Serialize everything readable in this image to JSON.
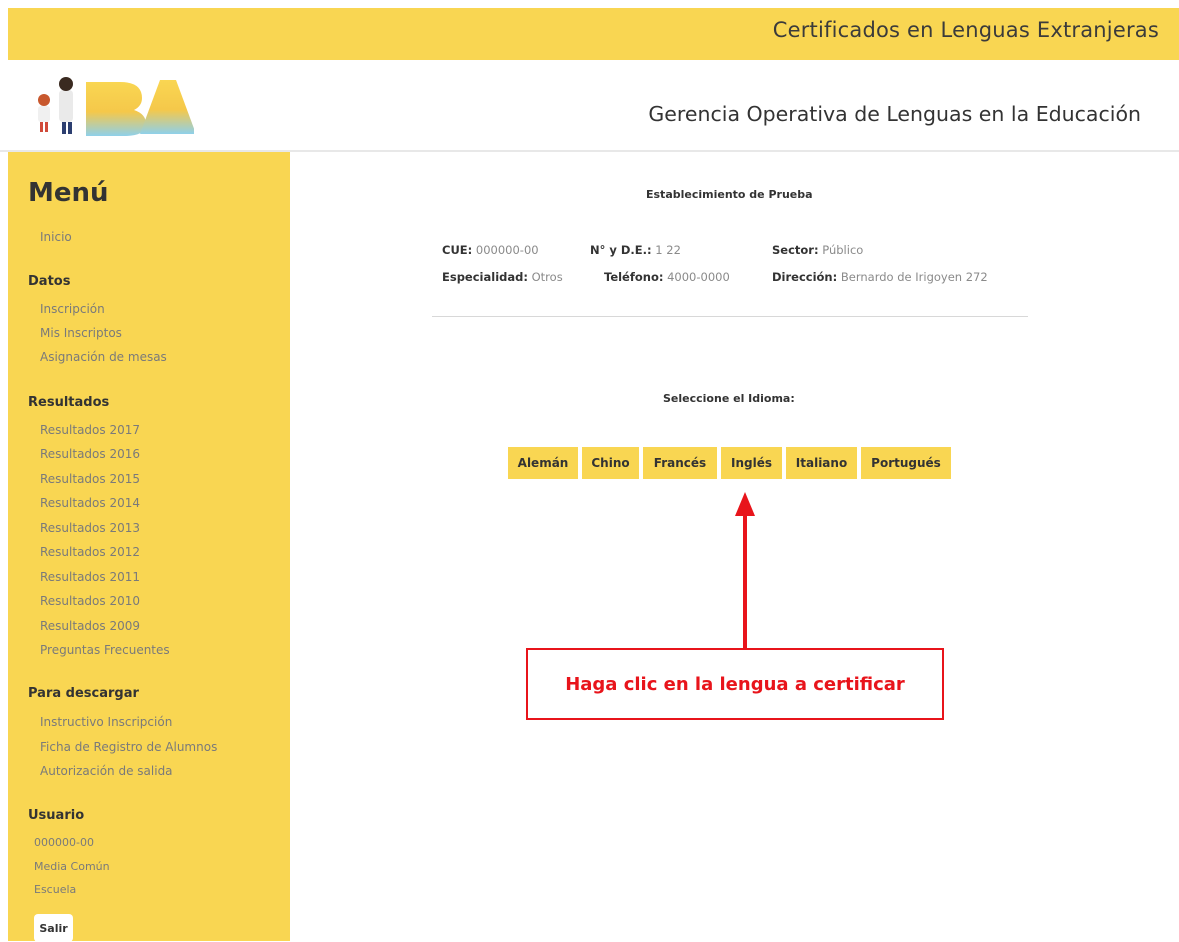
{
  "banner": {
    "title": "Certificados en Lenguas Extranjeras"
  },
  "header": {
    "subtitle": "Gerencia Operativa de Lenguas en la Educación"
  },
  "sidebar": {
    "menu_title": "Menú",
    "inicio": "Inicio",
    "datos": {
      "heading": "Datos",
      "items": [
        "Inscripción",
        "Mis Inscriptos",
        "Asignación de mesas"
      ]
    },
    "resultados": {
      "heading": "Resultados",
      "items": [
        "Resultados 2017",
        "Resultados 2016",
        "Resultados 2015",
        "Resultados 2014",
        "Resultados 2013",
        "Resultados 2012",
        "Resultados 2011",
        "Resultados 2010",
        "Resultados 2009",
        "Preguntas Frecuentes"
      ]
    },
    "descargar": {
      "heading": "Para descargar",
      "items": [
        "Instructivo Inscripción",
        "Ficha de Registro de Alumnos",
        "Autorización de salida"
      ]
    },
    "usuario": {
      "heading": "Usuario",
      "items": [
        "000000-00",
        "Media Común",
        "Escuela"
      ]
    },
    "logout_label": "Salir"
  },
  "school": {
    "name": "Establecimiento de Prueba",
    "cue_label": "CUE:",
    "cue_value": "000000-00",
    "nde_label": "N° y D.E.:",
    "nde_value": "1 22",
    "sector_label": "Sector:",
    "sector_value": "Público",
    "especialidad_label": "Especialidad:",
    "especialidad_value": "Otros",
    "telefono_label": "Teléfono:",
    "telefono_value": "4000-0000",
    "direccion_label": "Dirección:",
    "direccion_value": "Bernardo de Irigoyen 272"
  },
  "language_select": {
    "label": "Seleccione el Idioma:",
    "options": [
      "Alemán",
      "Chino",
      "Francés",
      "Inglés",
      "Italiano",
      "Portugués"
    ]
  },
  "annotation": {
    "text": "Haga clic en la lengua a certificar",
    "color": "#e8141b"
  },
  "colors": {
    "accent_yellow": "#f9d652"
  }
}
